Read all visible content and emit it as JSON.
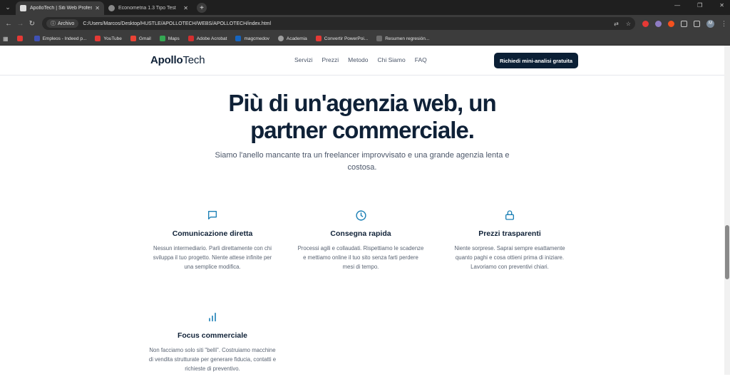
{
  "browser": {
    "tabs": [
      {
        "title": "ApolloTech | Siti Web Profess...",
        "active": true
      },
      {
        "title": "Econometria 1.3 Tipo Test",
        "active": false
      }
    ],
    "chip_label": "Archivo",
    "url": "C:/Users/Marcos/Desktop/HUSTLE/APOLLOTECH/WEBS/APOLLOTECH/index.html",
    "avatar_letter": "M",
    "bookmarks": [
      {
        "label": "",
        "color": "#e53935"
      },
      {
        "label": "Empleos - Indeed p...",
        "color": "#3f51b5"
      },
      {
        "label": "YouTube",
        "color": "#e53935"
      },
      {
        "label": "Gmail",
        "color": "#ea4335"
      },
      {
        "label": "Maps",
        "color": "#34a853"
      },
      {
        "label": "Adobe Acrobat",
        "color": "#d32f2f"
      },
      {
        "label": "magcmedov",
        "color": "#1565c0"
      },
      {
        "label": "Academia",
        "color": "#9e9e9e"
      },
      {
        "label": "Convertir PowerPoi...",
        "color": "#e53935"
      },
      {
        "label": "Resumen regresión...",
        "color": "#6d6d6d"
      }
    ]
  },
  "site": {
    "logo_bold": "Apollo",
    "logo_light": "Tech",
    "menu": [
      "Servizi",
      "Prezzi",
      "Metodo",
      "Chi Siamo",
      "FAQ"
    ],
    "cta_label": "Richiedi mini-analisi gratuita",
    "hero_title_line1": "Più di un'agenzia web, un",
    "hero_title_line2": "partner commerciale.",
    "hero_subtitle": "Siamo l'anello mancante tra un freelancer improvvisato e una grande agenzia lenta e costosa.",
    "accent_color": "#1a7fb5",
    "features": [
      {
        "icon": "chat-bubble-icon",
        "title": "Comunicazione diretta",
        "text": "Nessun intermediario. Parli direttamente con chi sviluppa il tuo progetto. Niente attese infinite per una semplice modifica."
      },
      {
        "icon": "clock-icon",
        "title": "Consegna rapida",
        "text": "Processi agili e collaudati. Rispettiamo le scadenze e mettiamo online il tuo sito senza farti perdere mesi di tempo."
      },
      {
        "icon": "lock-icon",
        "title": "Prezzi trasparenti",
        "text": "Niente sorprese. Saprai sempre esattamente quanto paghi e cosa ottieni prima di iniziare. Lavoriamo con preventivi chiari."
      },
      {
        "icon": "bar-chart-icon",
        "title": "Focus commerciale",
        "text": "Non facciamo solo siti \"belli\". Costruiamo macchine di vendita strutturate per generare fiducia, contatti e richieste di preventivo."
      }
    ]
  }
}
